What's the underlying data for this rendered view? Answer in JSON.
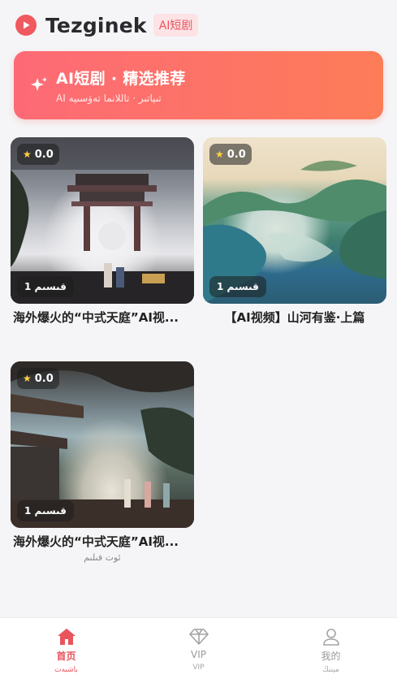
{
  "header": {
    "app_title": "Tezginek",
    "badge": "AI短剧",
    "logo_icon": "play-circle-icon",
    "accent_color": "#f0595f"
  },
  "banner": {
    "title": "AI短剧 · 精选推荐",
    "subtitle": "AI تىياتىر · تاللانما تەۋسىيە",
    "icon": "sparkle-icon",
    "gradient": [
      "#fd6a76",
      "#fd7c58"
    ]
  },
  "cards": [
    {
      "rating": "0.0",
      "episodes": "1 قىسىم",
      "title": "海外爆火的“中式天庭”AI视...",
      "subtitle": ""
    },
    {
      "rating": "0.0",
      "episodes": "1 قىسىم",
      "title": "【AI视频】山河有鉴·上篇",
      "subtitle": ""
    },
    {
      "rating": "0.0",
      "episodes": "1 قىسىم",
      "title": "海外爆火的“中式天庭”AI视...",
      "subtitle": "ئوت فىلىم"
    }
  ],
  "bottom_nav": {
    "items": [
      {
        "label": "首页",
        "sub": "باشبەت",
        "icon": "home-icon",
        "active": true
      },
      {
        "label": "VIP",
        "sub": "VIP",
        "icon": "diamond-icon",
        "active": false
      },
      {
        "label": "我的",
        "sub": "مېنىڭ",
        "icon": "user-icon",
        "active": false
      }
    ],
    "active_color": "#e9545d"
  }
}
